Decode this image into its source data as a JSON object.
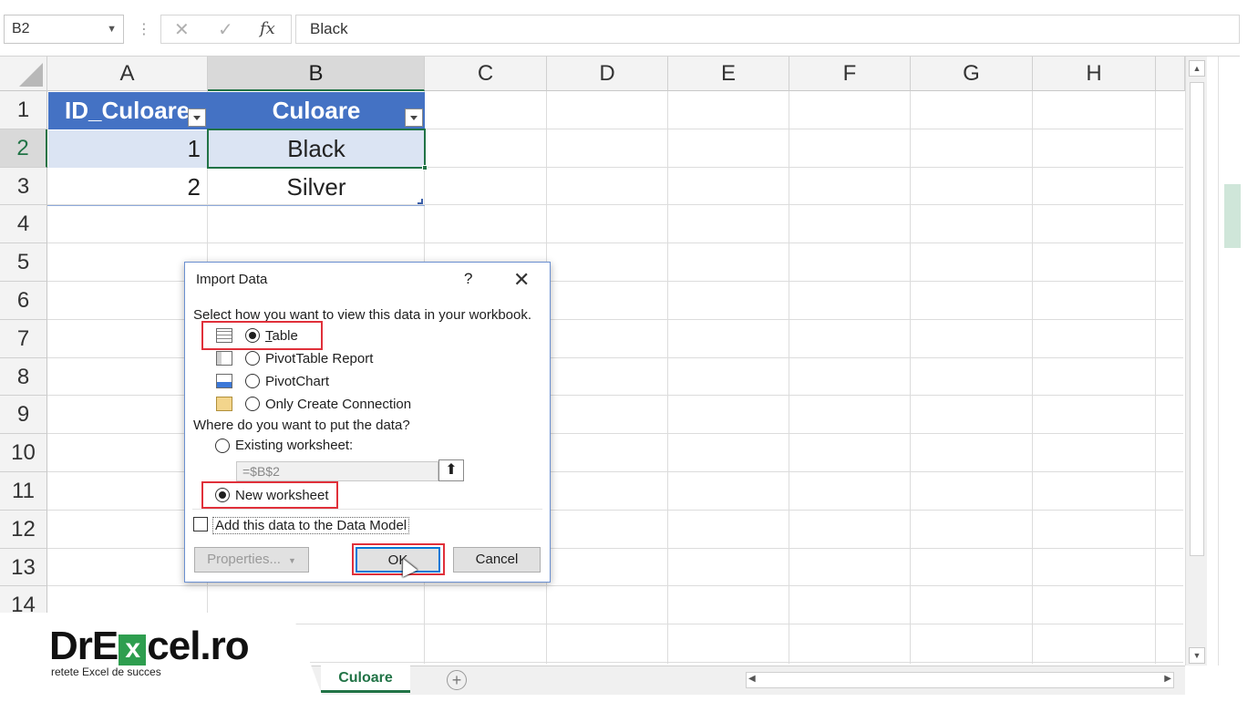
{
  "formula_bar": {
    "name_box": "B2",
    "cancel_glyph": "✕",
    "enter_glyph": "✓",
    "fx_label": "fx",
    "value": "Black"
  },
  "columns": [
    "A",
    "B",
    "C",
    "D",
    "E",
    "F",
    "G",
    "H"
  ],
  "rows": [
    "1",
    "2",
    "3",
    "4",
    "5",
    "6",
    "7",
    "8",
    "9",
    "10",
    "11",
    "12",
    "13",
    "14"
  ],
  "table": {
    "headers": [
      "ID_Culoare",
      "Culoare"
    ],
    "rows": [
      [
        "1",
        "Black"
      ],
      [
        "2",
        "Silver"
      ]
    ]
  },
  "dialog": {
    "title": "Import Data",
    "help": "?",
    "close": "✕",
    "view_prompt": "Select how you want to view this data in your workbook.",
    "view_options": [
      {
        "label": "Table",
        "selected": true,
        "icon": "table-icon"
      },
      {
        "label": "PivotTable Report",
        "selected": false,
        "icon": "pivottable-icon"
      },
      {
        "label": "PivotChart",
        "selected": false,
        "icon": "pivotchart-icon"
      },
      {
        "label": "Only Create Connection",
        "selected": false,
        "icon": "connection-icon"
      }
    ],
    "location_prompt": "Where do you want to put the data?",
    "existing_label": "Existing worksheet:",
    "existing_ref": "=$B$2",
    "new_label": "New worksheet",
    "data_model_label": "Add this data to the Data Model",
    "properties_label": "Properties...",
    "ok_label": "OK",
    "cancel_label": "Cancel"
  },
  "sheet_tabs": {
    "active": "Culoare",
    "add_glyph": "+"
  },
  "logo": {
    "part1": "DrE",
    "x": "x",
    "part2": "cel.ro",
    "tagline": "retete Excel de succes"
  },
  "colors": {
    "table_header": "#4472c4",
    "band": "#dbe4f3",
    "excel_green": "#217346",
    "highlight_red": "#e0303a"
  }
}
